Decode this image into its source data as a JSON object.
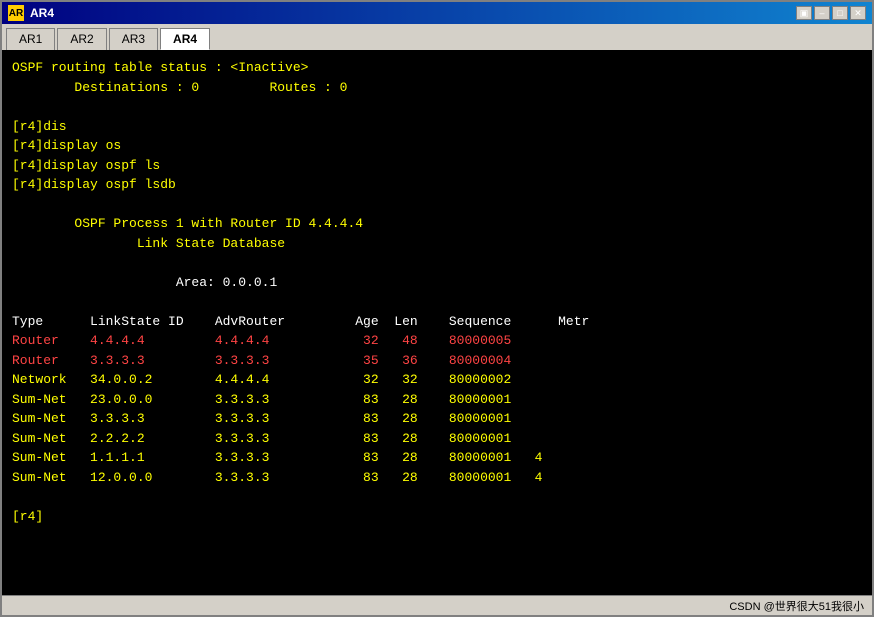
{
  "window": {
    "title": "AR4",
    "icon_label": "AR"
  },
  "title_buttons": {
    "restore": "▣",
    "minimize": "–",
    "maximize": "□",
    "close": "✕"
  },
  "tabs": [
    {
      "label": "AR1",
      "active": false
    },
    {
      "label": "AR2",
      "active": false
    },
    {
      "label": "AR3",
      "active": false
    },
    {
      "label": "AR4",
      "active": true
    }
  ],
  "terminal": {
    "lines": [
      {
        "text": "OSPF routing table status : <Inactive>",
        "type": "yellow"
      },
      {
        "text": "        Destinations : 0         Routes : 0",
        "type": "yellow"
      },
      {
        "text": "",
        "type": "yellow"
      },
      {
        "text": "[r4]dis",
        "type": "yellow"
      },
      {
        "text": "[r4]display os",
        "type": "yellow"
      },
      {
        "text": "[r4]display ospf ls",
        "type": "yellow"
      },
      {
        "text": "[r4]display ospf lsdb",
        "type": "yellow"
      },
      {
        "text": "",
        "type": "yellow"
      },
      {
        "text": "        OSPF Process 1 with Router ID 4.4.4.4",
        "type": "yellow"
      },
      {
        "text": "                Link State Database",
        "type": "yellow"
      },
      {
        "text": "",
        "type": "yellow"
      },
      {
        "text": "                     Area: 0.0.0.1",
        "type": "white"
      },
      {
        "text": "",
        "type": "yellow"
      },
      {
        "text": "Type      LinkState ID    AdvRouter         Age  Len    Sequence      Metr",
        "type": "white"
      },
      {
        "text": "Router    4.4.4.4         4.4.4.4            32   48    80000005",
        "type": "router_red"
      },
      {
        "text": "Router    3.3.3.3         3.3.3.3            35   36    80000004",
        "type": "router_red"
      },
      {
        "text": "Network   34.0.0.2        4.4.4.4            32   32    80000002",
        "type": "network"
      },
      {
        "text": "Sum-Net   23.0.0.0        3.3.3.3            83   28    80000001",
        "type": "yellow"
      },
      {
        "text": "Sum-Net   3.3.3.3         3.3.3.3            83   28    80000001",
        "type": "yellow"
      },
      {
        "text": "Sum-Net   2.2.2.2         3.3.3.3            83   28    80000001",
        "type": "yellow"
      },
      {
        "text": "Sum-Net   1.1.1.1         3.3.3.3            83   28    80000001   4",
        "type": "yellow"
      },
      {
        "text": "Sum-Net   12.0.0.0        3.3.3.3            83   28    80000001   4",
        "type": "yellow"
      }
    ],
    "prompt": "[r4]"
  },
  "status_bar": {
    "text": "CSDN @世界很大51我很小"
  }
}
